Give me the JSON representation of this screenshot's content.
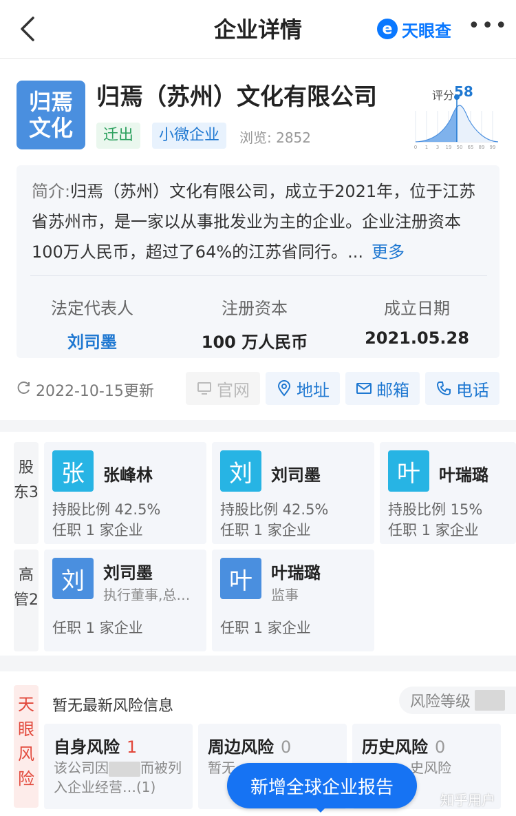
{
  "header": {
    "title": "企业详情",
    "brand_mark": "e",
    "brand_name": "天眼查",
    "more_label": "•••"
  },
  "company": {
    "logo_lines": [
      "归焉",
      "文化"
    ],
    "name": "归焉（苏州）文化有限公司",
    "tags": [
      "迁出",
      "小微企业"
    ],
    "views": "浏览: 2852",
    "score_label": "评分",
    "score_value": "58",
    "intro_label": "简介:",
    "intro_text": "归焉（苏州）文化有限公司，成立于2021年，位于江苏省苏州市，是一家以从事批发业为主的企业。企业注册资本100万人民币，超过了64%的江苏省同行。...",
    "intro_more": "更多",
    "fields": [
      {
        "label": "法定代表人",
        "value": "刘司墨"
      },
      {
        "label": "注册资本",
        "value": "100 万人民币"
      },
      {
        "label": "成立日期",
        "value": "2021.05.28"
      }
    ],
    "updated": "2022-10-15更新",
    "actions": [
      "官网",
      "地址",
      "邮箱",
      "电话"
    ]
  },
  "shareholders": {
    "label": "股东3",
    "items": [
      {
        "avatar": "张",
        "name": "张峰林",
        "ratio": "持股比例 42.5%",
        "jobs": "任职 1 家企业"
      },
      {
        "avatar": "刘",
        "name": "刘司墨",
        "ratio": "持股比例 42.5%",
        "jobs": "任职 1 家企业"
      },
      {
        "avatar": "叶",
        "name": "叶瑞璐",
        "ratio": "持股比例 15%",
        "jobs": "任职 1 家企业"
      }
    ]
  },
  "executives": {
    "label": "高管2",
    "items": [
      {
        "avatar": "刘",
        "name": "刘司墨",
        "role": "执行董事,总…",
        "jobs": "任职 1 家企业"
      },
      {
        "avatar": "叶",
        "name": "叶瑞璐",
        "role": "监事",
        "jobs": "任职 1 家企业"
      }
    ]
  },
  "risk": {
    "side_label": "天眼风险",
    "none_text": "暂无最新风险信息",
    "level_label": "风险等级",
    "cards": [
      {
        "title": "自身风险",
        "count": "1",
        "desc_a": "该公司因",
        "desc_b": "而被列入企业经营…(1)"
      },
      {
        "title": "周边风险",
        "count": "0",
        "desc_a": "暂无",
        "desc_b": ""
      },
      {
        "title": "历史风险",
        "count": "0",
        "desc_a": "",
        "desc_b": "史风险"
      }
    ]
  },
  "toast": "新增全球企业报告",
  "watermark": "知乎用户",
  "colors": {
    "accent": "#1f78d1",
    "brand": "#0a78ff",
    "risk": "#e2483b",
    "tag_green": "#2ea160"
  }
}
